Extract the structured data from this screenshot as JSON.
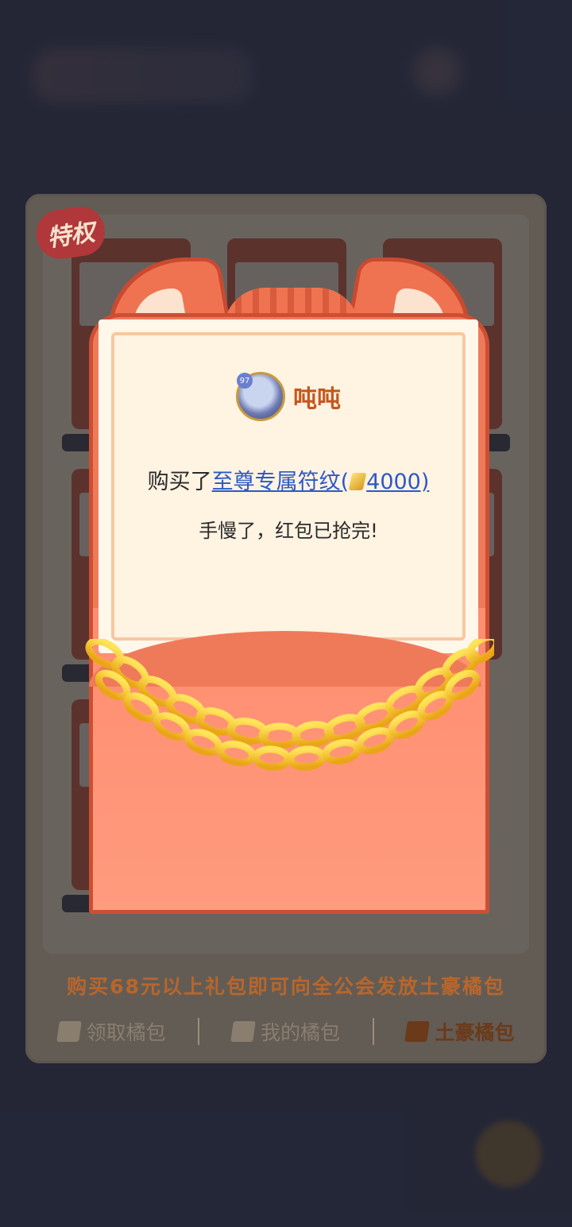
{
  "panel": {
    "badge": "特权",
    "footer_text": "购买68元以上礼包即可向全公会发放土豪橘包",
    "tabs": [
      {
        "label": "领取橘包",
        "icon": "cat-envelope-icon",
        "active": false
      },
      {
        "label": "我的橘包",
        "icon": "envelope-icon",
        "active": false
      },
      {
        "label": "土豪橘包",
        "icon": "gold-envelope-icon",
        "active": true
      }
    ]
  },
  "modal": {
    "username": "吨吨",
    "avatar_level": "97",
    "purchase_prefix": "购买了",
    "item_name": "至尊专属符纹(",
    "item_price": "4000)",
    "message": "手慢了，红包已抢完!"
  },
  "colors": {
    "envelope": "#ef7a5a",
    "envelope_border": "#cc4f34",
    "username": "#c4581f",
    "item_link": "#2b58c8",
    "footer_text": "#b8662c"
  }
}
